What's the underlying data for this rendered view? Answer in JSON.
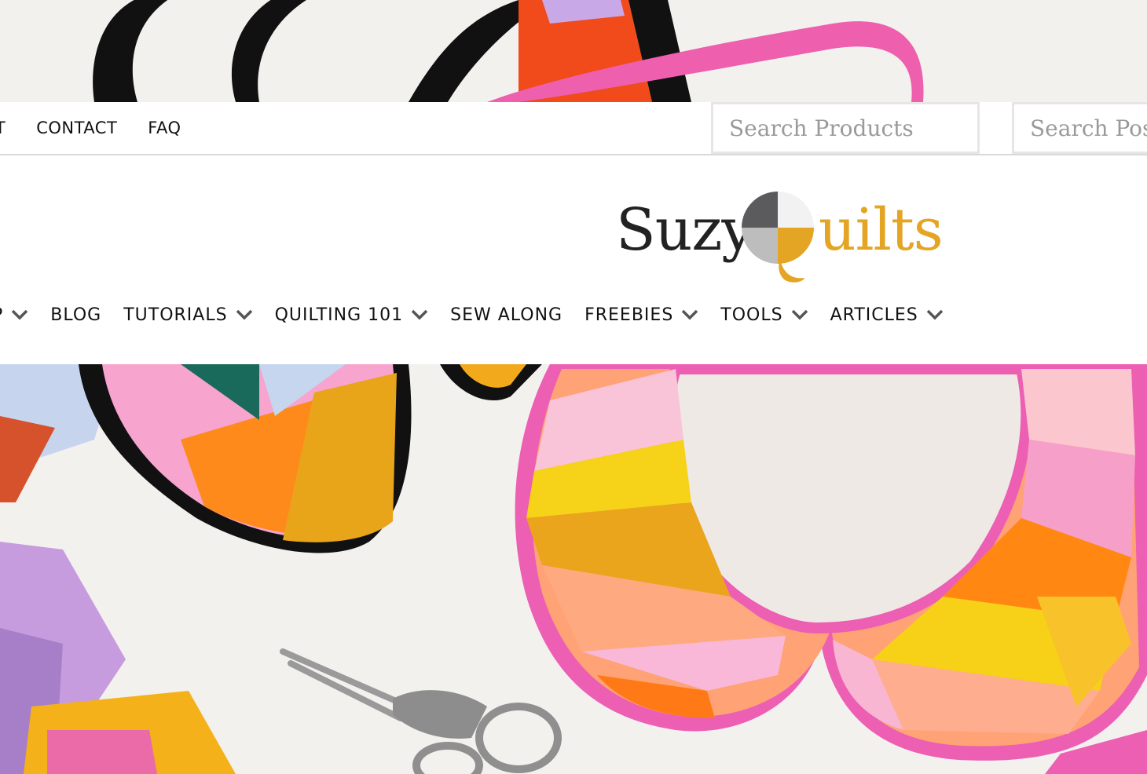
{
  "topnav": {
    "items": [
      "UT",
      "CONTACT",
      "FAQ"
    ]
  },
  "search": {
    "products_placeholder": "Search Products",
    "posts_placeholder": "Search Posts"
  },
  "logo": {
    "text_left": "Suzy",
    "text_right": "uilts",
    "colors": {
      "dark": "#5b5b5d",
      "light": "#f2f2f2",
      "gray": "#bdbdbd",
      "gold": "#e3a523"
    }
  },
  "mainnav": {
    "items": [
      {
        "label": "P",
        "has_dropdown": true
      },
      {
        "label": "BLOG",
        "has_dropdown": false
      },
      {
        "label": "TUTORIALS",
        "has_dropdown": true
      },
      {
        "label": "QUILTING 101",
        "has_dropdown": true
      },
      {
        "label": "SEW ALONG",
        "has_dropdown": false
      },
      {
        "label": "FREEBIES",
        "has_dropdown": true
      },
      {
        "label": "TOOLS",
        "has_dropdown": true
      },
      {
        "label": "ARTICLES",
        "has_dropdown": true
      }
    ],
    "chevron_icon": "chevron-down-icon",
    "chevron_color": "#555555"
  }
}
